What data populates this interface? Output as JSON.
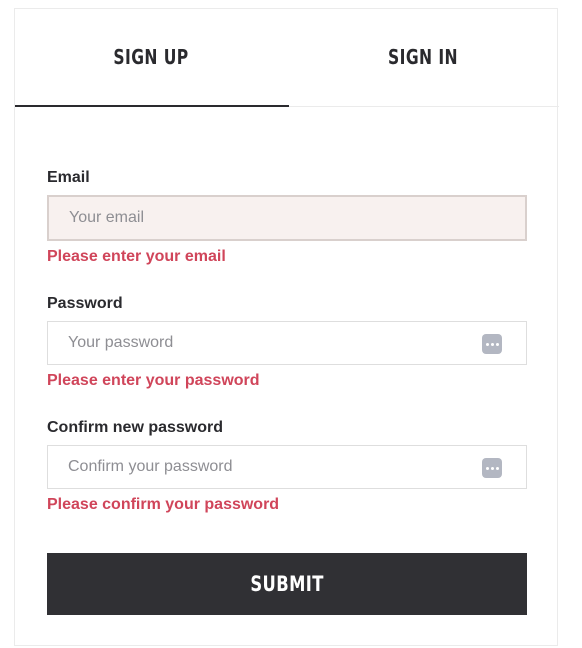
{
  "tabs": [
    {
      "label": "SIGN UP",
      "active": true
    },
    {
      "label": "SIGN IN",
      "active": false
    }
  ],
  "form": {
    "email": {
      "label": "Email",
      "placeholder": "Your email",
      "error": "Please enter your email"
    },
    "password": {
      "label": "Password",
      "placeholder": "Your password",
      "error": "Please enter your password",
      "icon": "password-dots-icon"
    },
    "confirm": {
      "label": "Confirm new password",
      "placeholder": "Confirm your password",
      "error": "Please confirm your password",
      "icon": "password-dots-icon"
    },
    "submit_label": "SUBMIT"
  },
  "colors": {
    "error": "#d0455a",
    "button": "#303034",
    "active_field_bg": "#f8f1ef"
  }
}
